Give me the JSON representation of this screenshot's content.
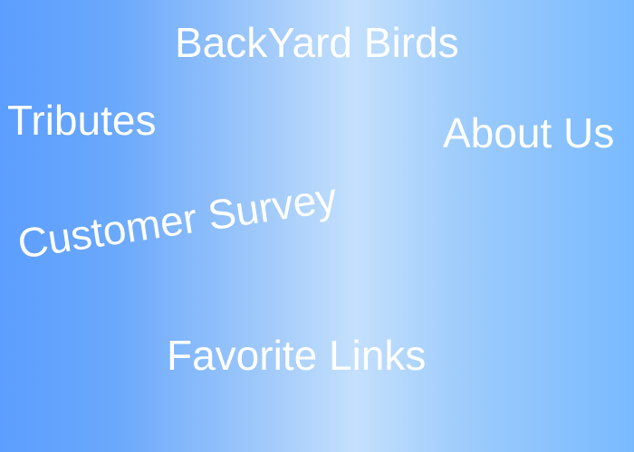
{
  "site": {
    "title": "BackYard Birds"
  },
  "nav": {
    "tributes": "Tributes",
    "about_us": "About Us",
    "customer_survey": "Customer Survey",
    "favorite_links": "Favorite Links"
  }
}
